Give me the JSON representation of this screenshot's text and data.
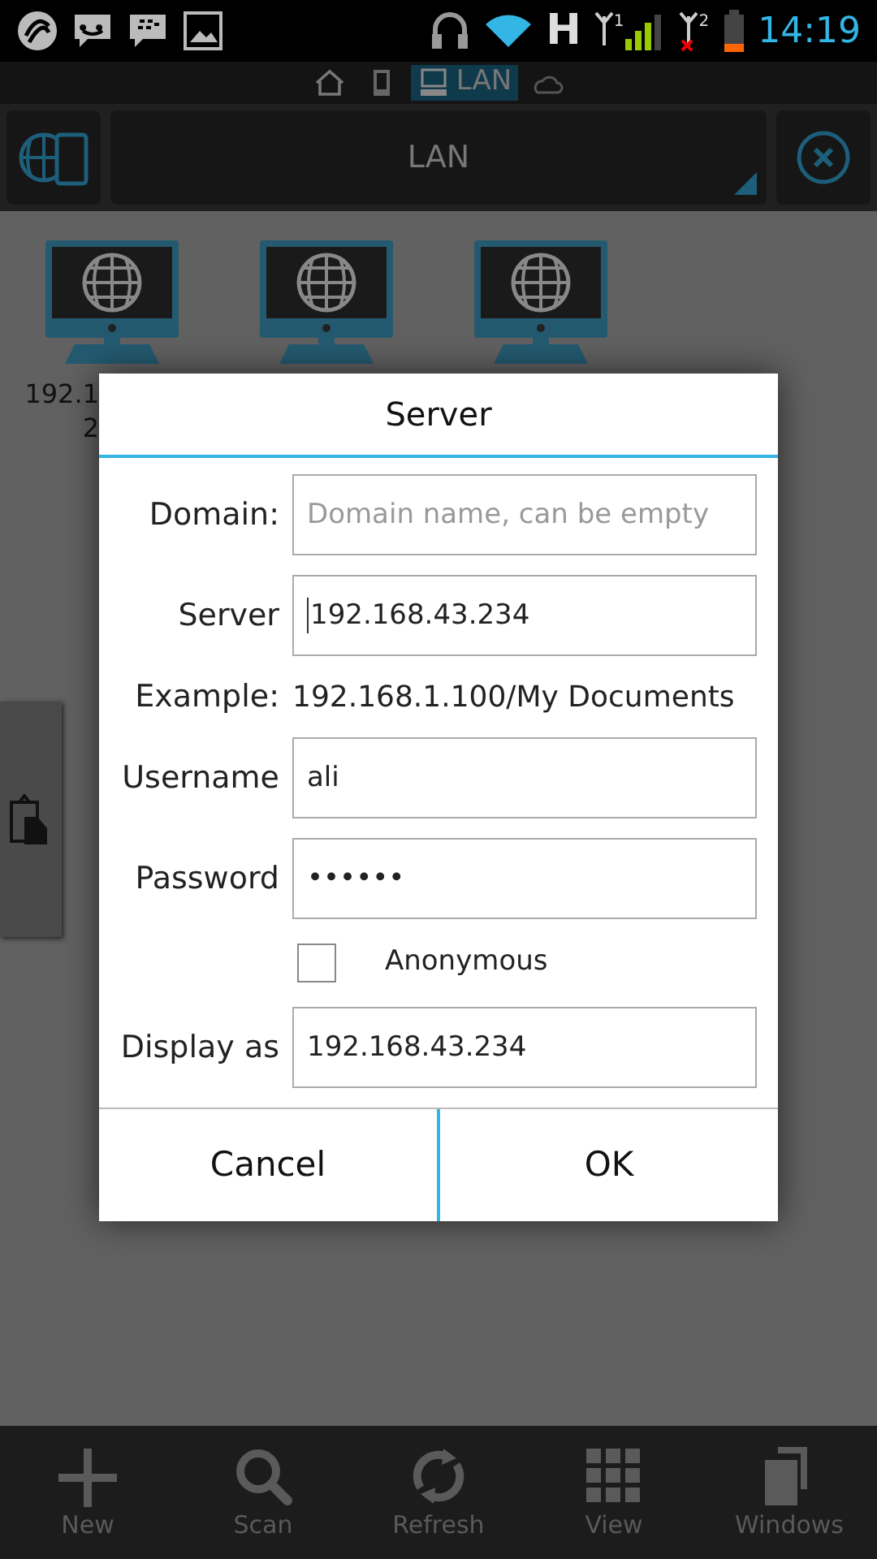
{
  "status_bar": {
    "network": "H",
    "sim_labels": [
      "1",
      "2"
    ],
    "time": "14:19"
  },
  "location_tabs": [
    {
      "kind": "home",
      "selected": false
    },
    {
      "kind": "device",
      "selected": false
    },
    {
      "kind": "lan",
      "label": "LAN",
      "selected": true
    },
    {
      "kind": "cloud",
      "selected": false
    }
  ],
  "path_bar": {
    "title": "LAN"
  },
  "files": [
    {
      "kind": "computer",
      "label_lines": [
        "192.1",
        "2"
      ]
    },
    {
      "kind": "computer"
    },
    {
      "kind": "computer"
    }
  ],
  "dialog": {
    "title": "Server",
    "rows": [
      {
        "kind": "field",
        "label": "Domain:",
        "placeholder": "Domain name, can be empty"
      },
      {
        "kind": "field",
        "label": "Server",
        "value": "192.168.43.234",
        "focused": true
      },
      {
        "kind": "example",
        "label": "Example:",
        "value": "192.168.1.100/My Documents"
      },
      {
        "kind": "field",
        "label": "Username",
        "value": "ali"
      },
      {
        "kind": "field",
        "label": "Password",
        "value": "••••••"
      },
      {
        "kind": "checkbox",
        "label": "Anonymous",
        "checked": false
      },
      {
        "kind": "field",
        "label": "Display as",
        "value": "192.168.43.234"
      }
    ],
    "buttons": [
      "Cancel",
      "OK"
    ]
  },
  "bottom_bar": [
    {
      "kind": "new",
      "label": "New"
    },
    {
      "kind": "scan",
      "label": "Scan"
    },
    {
      "kind": "refresh",
      "label": "Refresh"
    },
    {
      "kind": "view",
      "label": "View"
    },
    {
      "kind": "windows",
      "label": "Windows"
    }
  ]
}
